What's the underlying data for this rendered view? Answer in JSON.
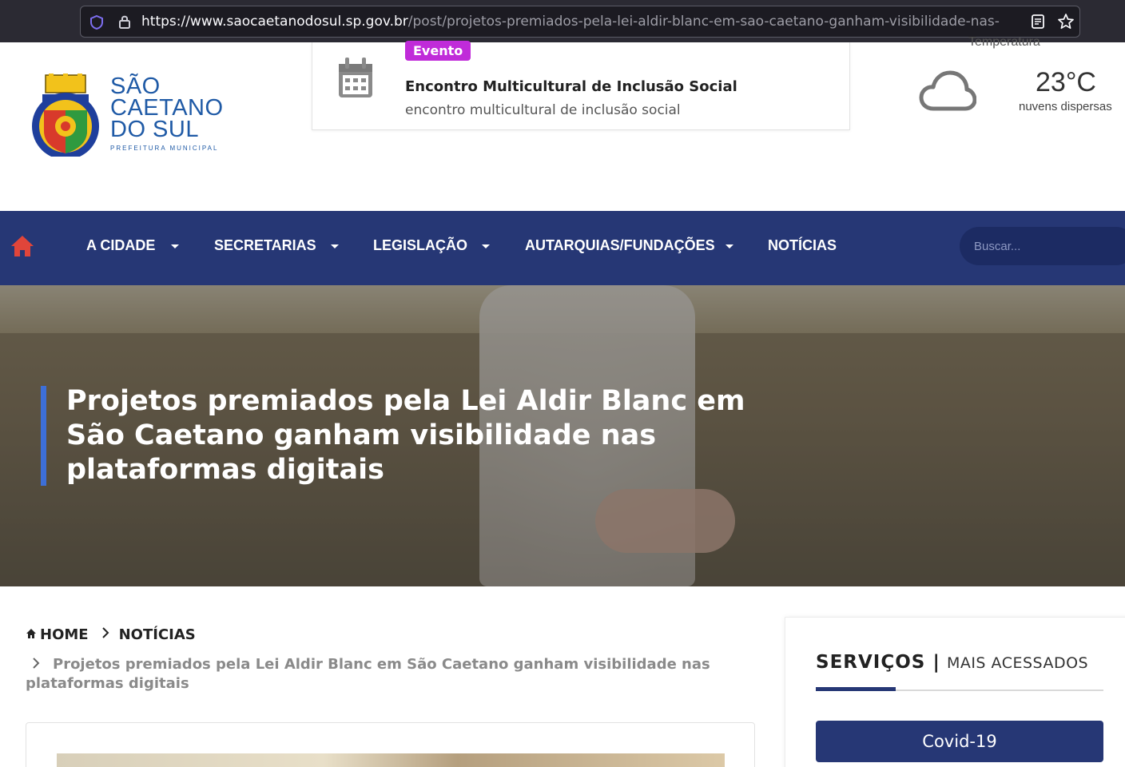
{
  "browser": {
    "url_host": "https://www.saocaetanodosul.sp.gov.br",
    "url_path": "/post/projetos-premiados-pela-lei-aldir-blanc-em-sao-caetano-ganham-visibilidade-nas-"
  },
  "header": {
    "logo": {
      "line1": "SÃO",
      "line2": "CAETANO",
      "line3": "DO SUL",
      "subtitle": "PREFEITURA MUNICIPAL"
    },
    "event": {
      "badge": "Evento",
      "title": "Encontro Multicultural de Inclusão Social",
      "description": "encontro multicultural de inclusão social"
    },
    "weather": {
      "label": "Temperatura",
      "temperature": "23°C",
      "description": "nuvens dispersas"
    }
  },
  "nav": {
    "items": [
      "A CIDADE",
      "SECRETARIAS",
      "LEGISLAÇÃO",
      "AUTARQUIAS/FUNDAÇÕES",
      "NOTÍCIAS"
    ],
    "search_placeholder": "Buscar..."
  },
  "hero": {
    "title": "Projetos premiados pela Lei Aldir Blanc em São Caetano ganham visibilidade nas plataformas digitais"
  },
  "breadcrumb": {
    "home": "HOME",
    "section": "NOTÍCIAS",
    "current": "Projetos premiados pela Lei Aldir Blanc em São Caetano ganham visibilidade nas plataformas digitais"
  },
  "sidebar": {
    "heading_strong": "SERVIÇOS",
    "heading_sep": "|",
    "heading_light": "MAIS ACESSADOS",
    "button_label": "Covid-19"
  },
  "colors": {
    "nav_background": "#263775",
    "event_badge": "#c02bd9",
    "home_icon": "#e0453a",
    "hero_accent": "#3d6fd8",
    "logo_text": "#1f5aa6"
  },
  "icons": {
    "address_bar": [
      "shield-icon",
      "lock-icon",
      "reader-view-icon",
      "bookmark-star-icon"
    ],
    "header": [
      "coat-of-arms-logo",
      "calendar-icon",
      "cloud-icon"
    ],
    "nav": [
      "home-icon",
      "chevron-down-icon"
    ],
    "breadcrumb": [
      "home-icon",
      "chevron-right-icon"
    ]
  }
}
